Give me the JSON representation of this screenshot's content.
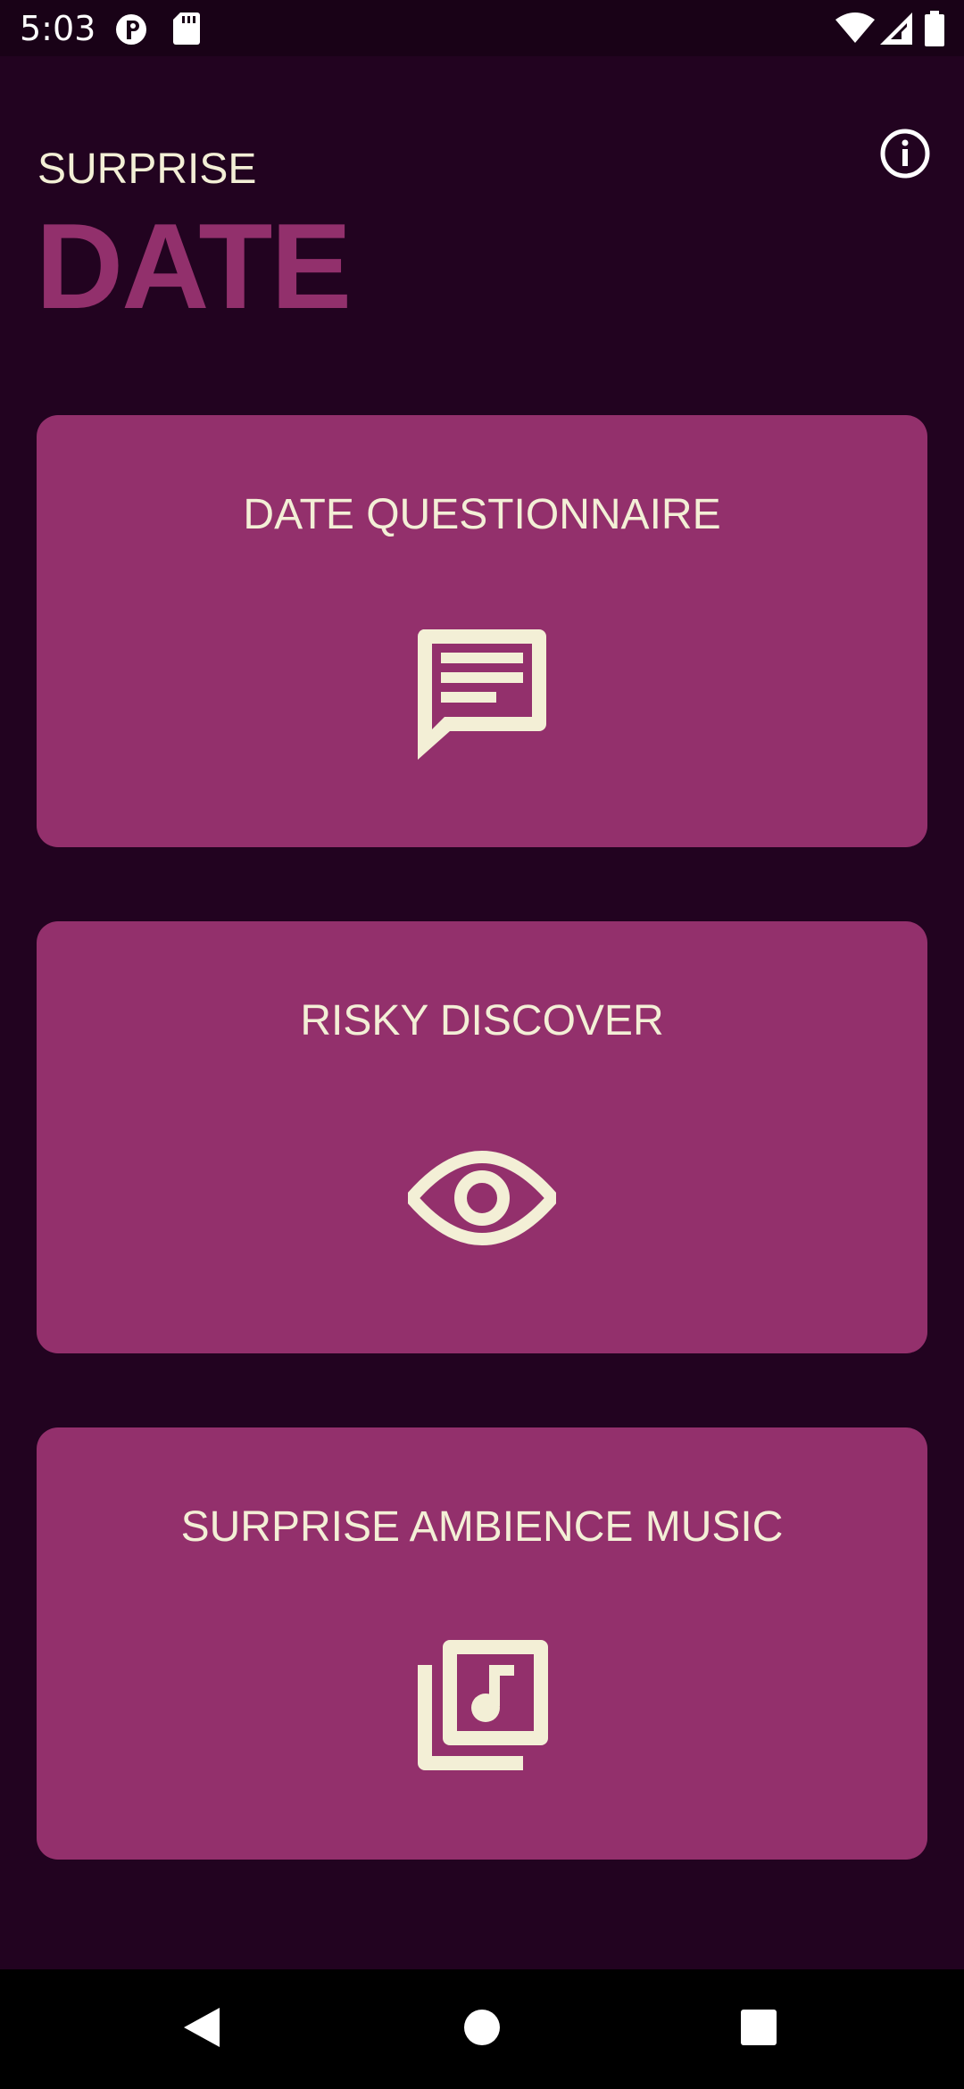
{
  "status_bar": {
    "time": "5:03",
    "icons": [
      "vpn-key-icon",
      "sd-card-icon",
      "wifi-icon",
      "cell-signal-icon",
      "battery-icon"
    ]
  },
  "header": {
    "subtitle": "SURPRISE",
    "title": "DATE",
    "info_icon": "info-icon"
  },
  "cards": [
    {
      "label": "DATE QUESTIONNAIRE",
      "icon": "chat-message-icon"
    },
    {
      "label": "RISKY DISCOVER",
      "icon": "eye-icon"
    },
    {
      "label": "SURPRISE AMBIENCE MUSIC",
      "icon": "music-library-icon"
    }
  ],
  "nav_bar": {
    "back": "back-icon",
    "home": "home-icon",
    "recents": "recents-icon"
  },
  "colors": {
    "background": "#220320",
    "card": "#93306c",
    "accent_title": "#92306c",
    "text": "#f3efd6"
  }
}
